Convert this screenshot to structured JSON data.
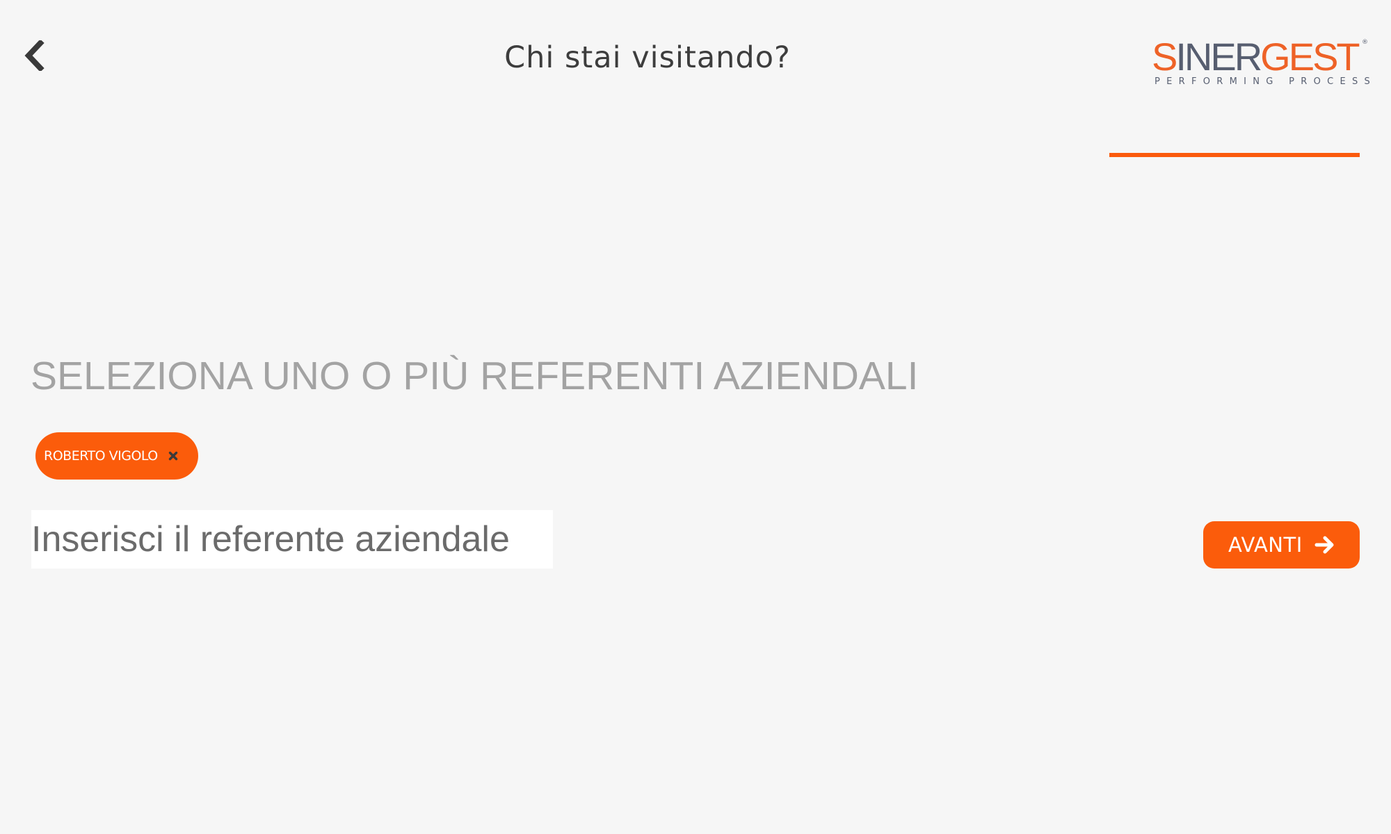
{
  "header": {
    "title": "Chi stai visitando?",
    "back_icon": "chevron-left-icon",
    "logo": {
      "wordmark_part1": "S",
      "wordmark_part2": "INER",
      "wordmark_part3": "GEST",
      "registered_mark": "®",
      "tagline": "PERFORMING PROCESS"
    }
  },
  "progress": {
    "fraction": 1.0,
    "color": "#fb5a0d"
  },
  "main": {
    "heading": "SELEZIONA UNO O PIÙ REFERENTI AZIENDALI",
    "selected_referents": [
      {
        "label": "ROBERTO VIGOLO",
        "remove_icon": "close-icon"
      }
    ],
    "referent_input": {
      "value": "",
      "placeholder": "Inserisci il referente aziendale"
    },
    "next_button": {
      "label": "AVANTI",
      "icon": "arrow-right-icon"
    }
  },
  "colors": {
    "accent": "#fb5c0b",
    "background": "#f6f6f6",
    "heading": "#a3a3a3",
    "title": "#3d3d3d",
    "logo_orange": "#ee6227",
    "logo_grey": "#575e70"
  }
}
